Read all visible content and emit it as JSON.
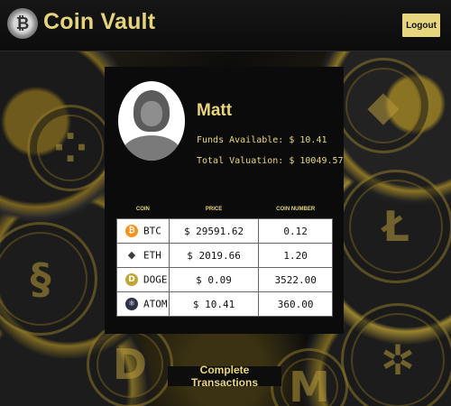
{
  "header": {
    "brand": "Coin Vault",
    "logo_text": "₿",
    "logout_label": "Logout"
  },
  "profile": {
    "name": "Matt",
    "funds_label": "Funds Available: $ 10.41",
    "total_label": "Total Valuation: $ 10049.57"
  },
  "table": {
    "headers": [
      "COIN",
      "PRICE",
      "COIN NUMBER"
    ],
    "rows": [
      {
        "symbol": "BTC",
        "icon": "bitcoin-icon",
        "glyph": "₿",
        "color": "#f7931a",
        "price": "$ 29591.62",
        "number": "0.12"
      },
      {
        "symbol": "ETH",
        "icon": "ethereum-icon",
        "glyph": "◆",
        "color": "#3c3c3d",
        "price": "$ 2019.66",
        "number": "1.20"
      },
      {
        "symbol": "DOGE",
        "icon": "dogecoin-icon",
        "glyph": "D",
        "color": "#c2a633",
        "price": "$ 0.09",
        "number": "3522.00"
      },
      {
        "symbol": "ATOM",
        "icon": "cosmos-icon",
        "glyph": "⚛",
        "color": "#2e3148",
        "price": "$ 10.41",
        "number": "360.00"
      }
    ]
  },
  "actions": {
    "complete_label": "Complete Transactions"
  },
  "colors": {
    "accent": "#e9d67b",
    "panel": "#0b0b0b"
  }
}
